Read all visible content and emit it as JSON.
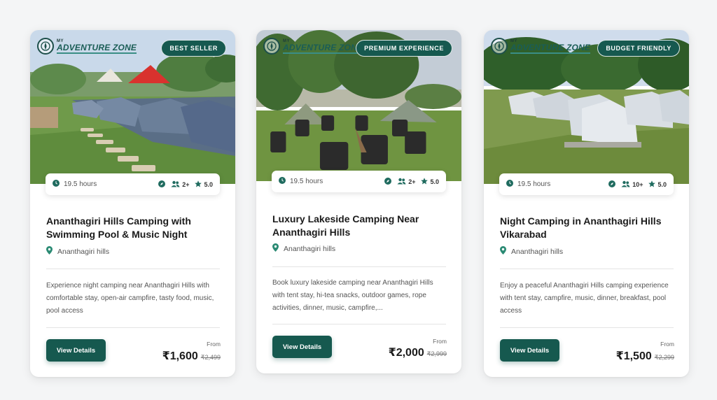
{
  "brand": {
    "prefix": "MY",
    "name": "ADVENTURE ZONE"
  },
  "colors": {
    "accent": "#16594f",
    "text": "#1b1b1b",
    "muted": "#555555"
  },
  "cards": [
    {
      "badge": "BEST SELLER",
      "duration": "19.5 hours",
      "group": "2+",
      "rating": "5.0",
      "title": "Ananthagiri Hills Camping with Swimming Pool & Music Night",
      "location": "Ananthagiri hills",
      "description": "Experience night camping near Ananthagiri Hills with comfortable stay, open-air campfire, tasty food, music, pool access",
      "button": "View Details",
      "from_label": "From",
      "price": "₹1,600",
      "old_price": "₹2,499"
    },
    {
      "badge": "PREMIUM EXPERIENCE",
      "duration": "19.5 hours",
      "group": "2+",
      "rating": "5.0",
      "title": "Luxury Lakeside Camping Near Ananthagiri Hills",
      "location": "Ananthagiri hills",
      "description": "Book luxury lakeside camping near Ananthagiri Hills with tent stay, hi-tea snacks, outdoor games, rope activities, dinner, music, campfire,...",
      "button": "View Details",
      "from_label": "From",
      "price": "₹2,000",
      "old_price": "₹2,999"
    },
    {
      "badge": "BUDGET FRIENDLY",
      "duration": "19.5 hours",
      "group": "10+",
      "rating": "5.0",
      "title": "Night Camping in Ananthagiri Hills Vikarabad",
      "location": "Ananthagiri hills",
      "description": "Enjoy a peaceful Ananthagiri Hills camping experience with tent stay, campfire, music, dinner, breakfast, pool access",
      "button": "View Details",
      "from_label": "From",
      "price": "₹1,500",
      "old_price": "₹2,299"
    }
  ]
}
